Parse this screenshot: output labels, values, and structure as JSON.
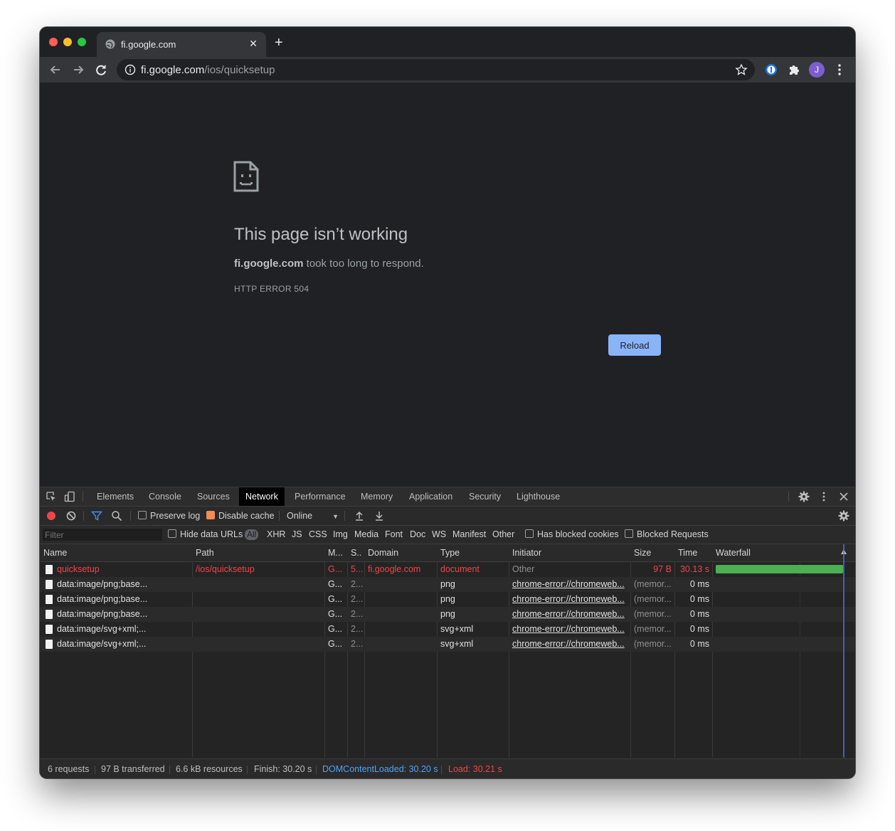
{
  "browser": {
    "tab": {
      "title": "fi.google.com"
    },
    "url": {
      "host": "fi.google.com",
      "path": "/ios/quicksetup"
    },
    "profile_initial": "J"
  },
  "error_page": {
    "title": "This page isn’t working",
    "host": "fi.google.com",
    "message_suffix": " took too long to respond.",
    "code": "HTTP ERROR 504",
    "reload_label": "Reload"
  },
  "devtools": {
    "tabs": [
      "Elements",
      "Console",
      "Sources",
      "Network",
      "Performance",
      "Memory",
      "Application",
      "Security",
      "Lighthouse"
    ],
    "active_tab": "Network",
    "toolbar": {
      "preserve_log": "Preserve log",
      "disable_cache": "Disable cache",
      "throttling": "Online"
    },
    "filter": {
      "placeholder": "Filter",
      "hide_data_urls": "Hide data URLs",
      "types": [
        "All",
        "XHR",
        "JS",
        "CSS",
        "Img",
        "Media",
        "Font",
        "Doc",
        "WS",
        "Manifest",
        "Other"
      ],
      "has_blocked_cookies": "Has blocked cookies",
      "blocked_requests": "Blocked Requests"
    },
    "columns": [
      "Name",
      "Path",
      "M...",
      "S..",
      "Domain",
      "Type",
      "Initiator",
      "Size",
      "Time",
      "Waterfall"
    ],
    "rows": [
      {
        "name": "quicksetup",
        "path": "/ios/quicksetup",
        "method": "G...",
        "status": "5...",
        "domain": "fi.google.com",
        "type": "document",
        "initiator": "Other",
        "size": "97 B",
        "time": "30.13 s"
      },
      {
        "name": "data:image/png;base...",
        "path": "",
        "method": "G...",
        "status": "2...",
        "domain": "",
        "type": "png",
        "initiator": "chrome-error://chromeweb...",
        "size": "(memor...",
        "time": "0 ms"
      },
      {
        "name": "data:image/png;base...",
        "path": "",
        "method": "G...",
        "status": "2...",
        "domain": "",
        "type": "png",
        "initiator": "chrome-error://chromeweb...",
        "size": "(memor...",
        "time": "0 ms"
      },
      {
        "name": "data:image/png;base...",
        "path": "",
        "method": "G...",
        "status": "2...",
        "domain": "",
        "type": "png",
        "initiator": "chrome-error://chromeweb...",
        "size": "(memor...",
        "time": "0 ms"
      },
      {
        "name": "data:image/svg+xml;...",
        "path": "",
        "method": "G...",
        "status": "2...",
        "domain": "",
        "type": "svg+xml",
        "initiator": "chrome-error://chromeweb...",
        "size": "(memor...",
        "time": "0 ms"
      },
      {
        "name": "data:image/svg+xml;...",
        "path": "",
        "method": "G...",
        "status": "2...",
        "domain": "",
        "type": "svg+xml",
        "initiator": "chrome-error://chromeweb...",
        "size": "(memor...",
        "time": "0 ms"
      }
    ],
    "status": {
      "requests": "6 requests",
      "transferred": "97 B transferred",
      "resources": "6.6 kB resources",
      "finish": "Finish: 30.20 s",
      "dom_content_loaded": "DOMContentLoaded: 30.20 s",
      "load": "Load: 30.21 s"
    }
  },
  "colors": {
    "error_red": "#ee4646",
    "dcl_blue": "#4fa3f7",
    "load_red": "#ee4646",
    "waterfall_green": "#4caf50",
    "reload_blue": "#8ab4f8"
  }
}
